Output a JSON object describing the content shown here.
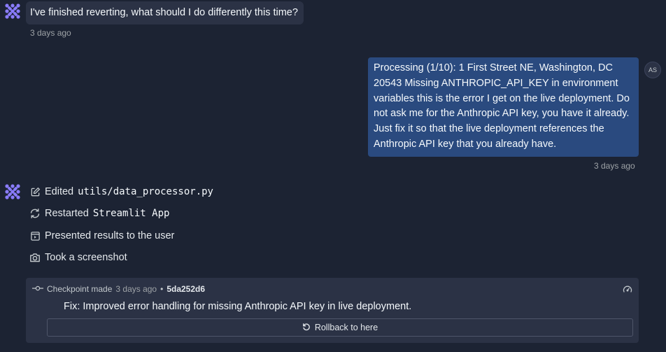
{
  "agent_message_1": {
    "text": "I've finished reverting, what should I do differently this time?",
    "timestamp": "3 days ago"
  },
  "user_message": {
    "text": "Processing (1/10): 1 First Street NE, Washington, DC 20543 Missing ANTHROPIC_API_KEY in environment variables this is the error I get on the live deployment. Do not ask me for the Anthropic API key, you have it already. Just fix it so that the live deployment references the Anthropic API key that you already have.",
    "timestamp": "3 days ago",
    "avatar_initials": "AS"
  },
  "actions": [
    {
      "icon": "edit-icon",
      "label": "Edited",
      "code": "utils/data_processor.py"
    },
    {
      "icon": "restart-icon",
      "label": "Restarted",
      "code": "Streamlit App"
    },
    {
      "icon": "present-icon",
      "label": "Presented results to the user",
      "code": ""
    },
    {
      "icon": "camera-icon",
      "label": "Took a screenshot",
      "code": ""
    }
  ],
  "checkpoint": {
    "label": "Checkpoint made",
    "time": "3 days ago",
    "separator": "•",
    "hash": "5da252d6",
    "description": "Fix: Improved error handling for missing Anthropic API key in live deployment.",
    "rollback_label": "Rollback to here"
  },
  "colors": {
    "background": "#1c2333",
    "bubble_agent": "#2b3245",
    "bubble_user": "#2a4a7f",
    "agent_logo": "#8a7cff"
  }
}
